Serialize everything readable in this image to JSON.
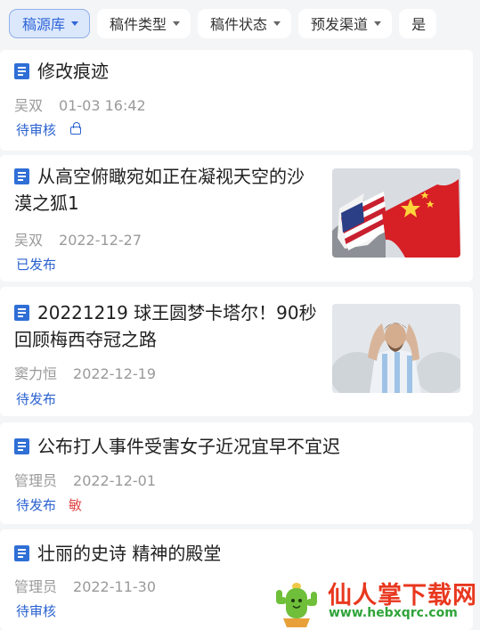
{
  "filters": [
    {
      "label": "稿源库",
      "active": true
    },
    {
      "label": "稿件类型",
      "active": false
    },
    {
      "label": "稿件状态",
      "active": false
    },
    {
      "label": "预发渠道",
      "active": false
    },
    {
      "label": "是",
      "active": false
    }
  ],
  "articles": [
    {
      "title": "修改痕迹",
      "author": "吴双",
      "time": "01-03 16:42",
      "status": "待审核",
      "locked": true,
      "thumbnail": null
    },
    {
      "title": "从高空俯瞰宛如正在凝视天空的沙漠之狐1",
      "author": "吴双",
      "time": "2022-12-27",
      "status": "已发布",
      "thumbnail": "us-china-flags"
    },
    {
      "title": "20221219 球王圆梦卡塔尔！90秒回顾梅西夺冠之路",
      "author": "窦力恒",
      "time": "2022-12-19",
      "status": "待发布",
      "thumbnail": "messi-celebrating"
    },
    {
      "title": "公布打人事件受害女子近况宜早不宜迟",
      "author": "管理员",
      "time": "2022-12-01",
      "status": "待发布",
      "sensitive": "敏",
      "thumbnail": null
    },
    {
      "title": "壮丽的史诗 精神的殿堂",
      "author": "管理员",
      "time": "2022-11-30",
      "status": "待审核",
      "thumbnail": null
    }
  ],
  "watermark": {
    "name": "仙人掌下载网",
    "url": "www.hebxqrc.com"
  },
  "colors": {
    "accent": "#2a62d0",
    "sensitive": "#e14848",
    "icon": "#2f6fd6"
  }
}
